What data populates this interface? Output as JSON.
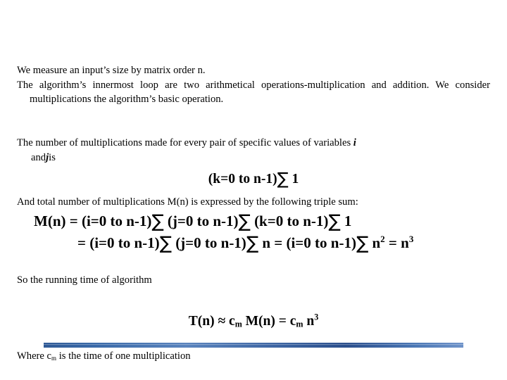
{
  "slide": {
    "background_color": "#ffffff",
    "text_color": "#000000",
    "accent_color": "#3a6aa8",
    "paragraph_1": {
      "line_1": "We measure an input’s size by matrix order n.",
      "line_2": "The algorithm’s innermost loop are two arithmetical operations-multiplication and addition. We consider  multiplications the algorithm’s basic operation."
    },
    "paragraph_2": {
      "text_before_i": "The number of multiplications made for every pair of specific values of variables ",
      "var_i": "i",
      "text_middle": "and",
      "var_j": "j",
      "text_after_j": "is"
    },
    "formula_1": {
      "bounds": "(k=0 to n-1)",
      "sigma": "∑",
      "body": "1"
    },
    "paragraph_3": {
      "text": "And total number of multiplications M(n) is expressed by the following triple sum:"
    },
    "formula_2": {
      "lhs": "M(n) = ",
      "bound_i": "(i=0 to n-1)",
      "sigma": "∑",
      "bound_j": " (j=0 to n-1)",
      "bound_k": " (k=0 to n-1)",
      "body": " 1"
    },
    "formula_3": {
      "lhs": "= ",
      "bound_i": "(i=0 to n-1)",
      "sigma": "∑",
      "bound_j": " (j=0 to n-1)",
      "mid": " n = ",
      "bound_i2": "(i=0 to n-1)",
      "base_n": " n",
      "exp_2": "2",
      "equals": " = n",
      "exp_3": "3"
    },
    "paragraph_4": {
      "text": "So the running time of algorithm"
    },
    "formula_4": {
      "tn": "T(n) ≈ c",
      "sub_m1": "m",
      "mn": " M(n) = c",
      "sub_m2": "m",
      "base_n": " n",
      "exp_3": "3"
    },
    "paragraph_5": {
      "text_before": "Where c",
      "sub_m": "m",
      "text_after": " is the time of one multiplication"
    }
  }
}
